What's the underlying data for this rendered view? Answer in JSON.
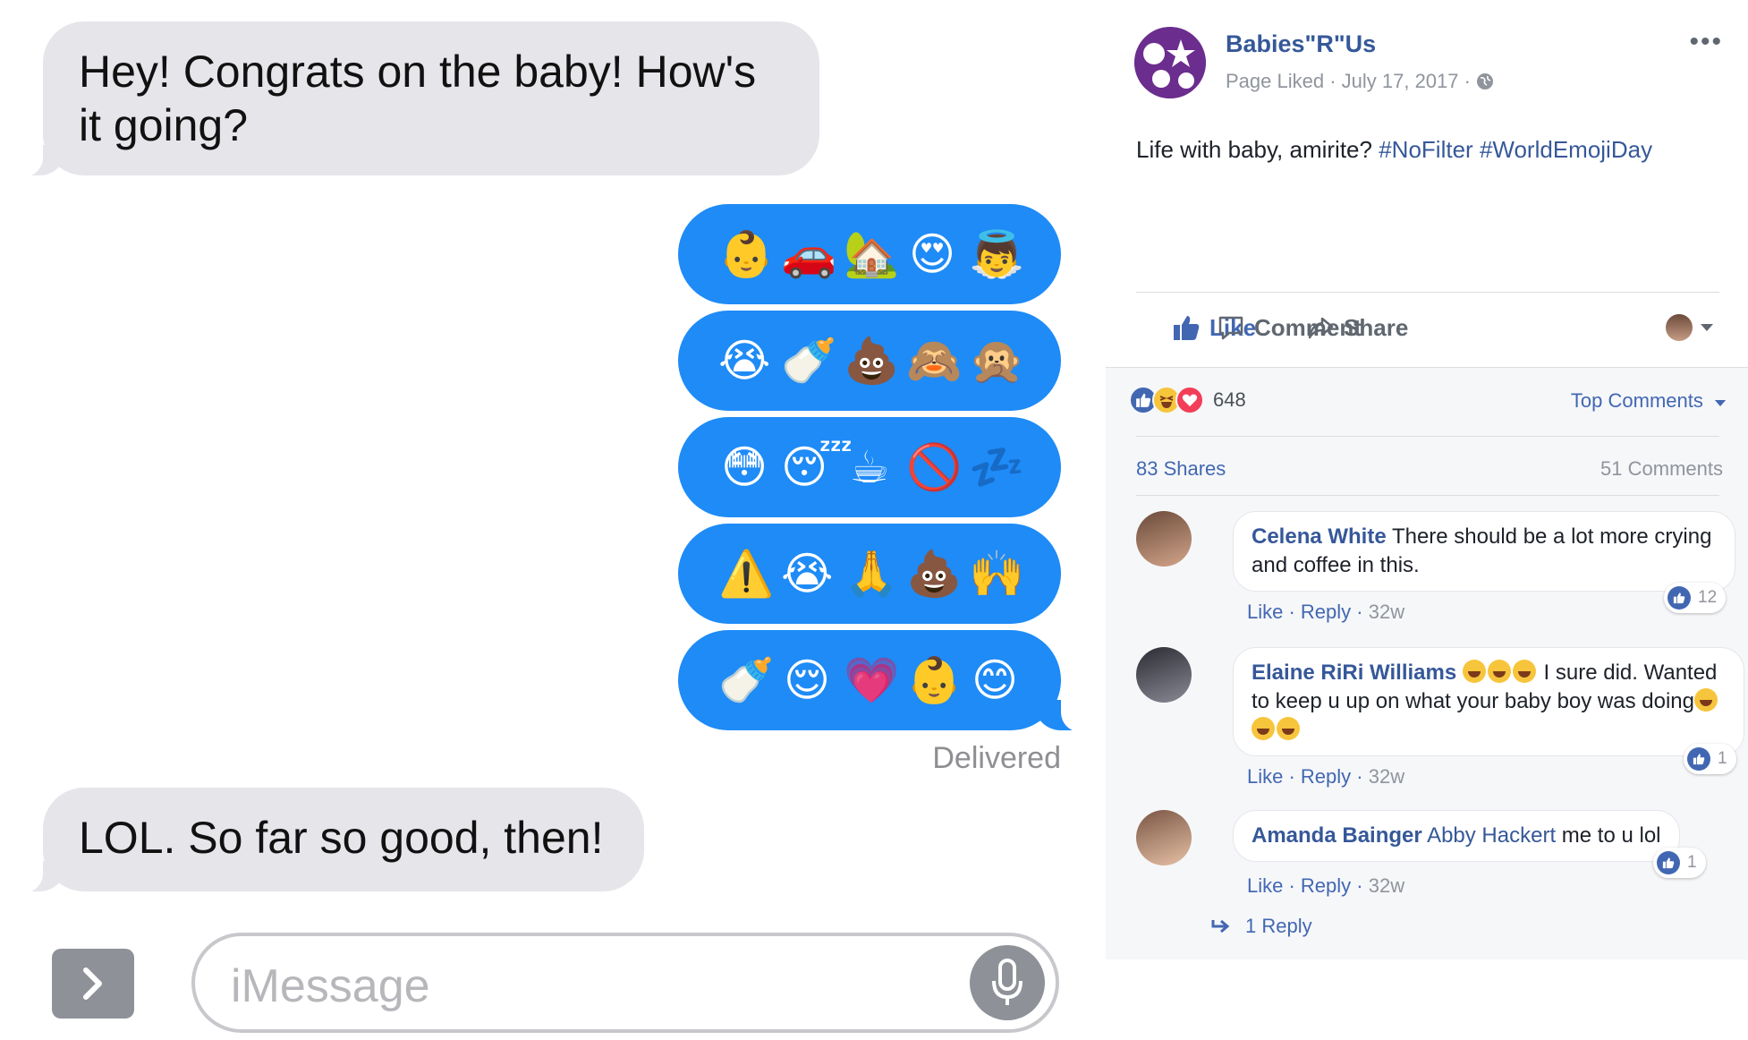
{
  "imessage": {
    "incoming_1": "Hey! Congrats on the baby! How's it going?",
    "emoji_rows": [
      [
        "👶",
        "🚗",
        "🏡",
        "😍",
        "👼"
      ],
      [
        "😭",
        "🍼",
        "💩",
        "🙈",
        "🙊"
      ],
      [
        "😳",
        "😴",
        "☕",
        "🚫",
        "💤"
      ],
      [
        "⚠️",
        "😭",
        "🙏",
        "💩",
        "🙌"
      ],
      [
        "🍼",
        "😌",
        "💗",
        "👶",
        "😊"
      ]
    ],
    "delivered": "Delivered",
    "incoming_2": "LOL. So far so good, then!",
    "input_placeholder": "iMessage"
  },
  "facebook": {
    "page_name": "Babies\"R\"Us",
    "page_meta": "Page Liked · July 17, 2017 ·",
    "post_text": "Life with baby, amirite?",
    "hashtags": [
      "#NoFilter",
      "#WorldEmojiDay"
    ],
    "actions": {
      "like": "Like",
      "comment": "Comment",
      "share": "Share"
    },
    "reaction_count": "648",
    "top_comments": "Top Comments",
    "shares": "83 Shares",
    "comments_count": "51 Comments",
    "comments": [
      {
        "author": "Celena White",
        "text": "There should be a lot more crying and coffee in this.",
        "like": "Like",
        "reply": "Reply",
        "time": "32w",
        "likes": "12"
      },
      {
        "author": "Elaine RiRi Williams",
        "text_a": "I sure did. Wanted to keep u up on what your baby boy was doing",
        "like": "Like",
        "reply": "Reply",
        "time": "32w",
        "likes": "1"
      },
      {
        "author": "Amanda Bainger",
        "tag": "Abby Hackert",
        "text": "me to u lol",
        "like": "Like",
        "reply": "Reply",
        "time": "32w",
        "likes": "1"
      }
    ],
    "replies_link": "1 Reply",
    "colors": {
      "fb_blue": "#4267b2",
      "link_blue": "#365899",
      "imessage_blue": "#1e8bf7",
      "bubble_gray": "#e5e5ea"
    }
  }
}
